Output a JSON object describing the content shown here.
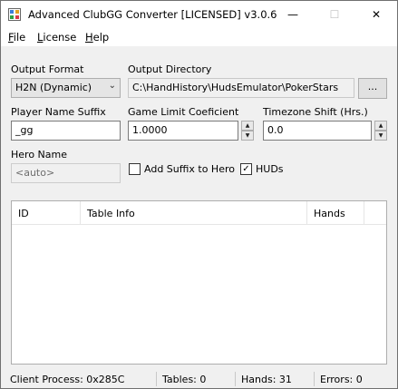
{
  "window": {
    "title": "Advanced ClubGG Converter [LICENSED] v3.0.6",
    "icon": "app-icon",
    "controls": {
      "minimize": "—",
      "maximize": "☐",
      "close": "✕"
    }
  },
  "menu": [
    {
      "label": "File",
      "key": "F",
      "rest": "ile"
    },
    {
      "label": "License",
      "key": "L",
      "rest": "icense"
    },
    {
      "label": "Help",
      "key": "H",
      "rest": "elp"
    }
  ],
  "form": {
    "output_format": {
      "label": "Output Format",
      "value": "H2N (Dynamic)"
    },
    "output_directory": {
      "label": "Output Directory",
      "value": "C:\\HandHistory\\HudsEmulator\\PokerStars",
      "browse_label": "..."
    },
    "player_name_suffix": {
      "label": "Player Name Suffix",
      "value": "_gg"
    },
    "game_limit_coefficient": {
      "label": "Game Limit Coeficient",
      "value": "1.0000"
    },
    "timezone_shift": {
      "label": "Timezone Shift (Hrs.)",
      "value": "0.0"
    },
    "hero_name": {
      "label": "Hero Name",
      "value": "<auto>"
    },
    "add_suffix_to_hero": {
      "label": "Add Suffix to Hero",
      "checked": false
    },
    "huds": {
      "label": "HUDs",
      "checked": true
    }
  },
  "table": {
    "columns": [
      "ID",
      "Table Info",
      "Hands"
    ],
    "rows": []
  },
  "status": {
    "client_process": "Client Process:  0x285C",
    "tables": "Tables: 0",
    "hands": "Hands: 31",
    "errors": "Errors: 0"
  }
}
